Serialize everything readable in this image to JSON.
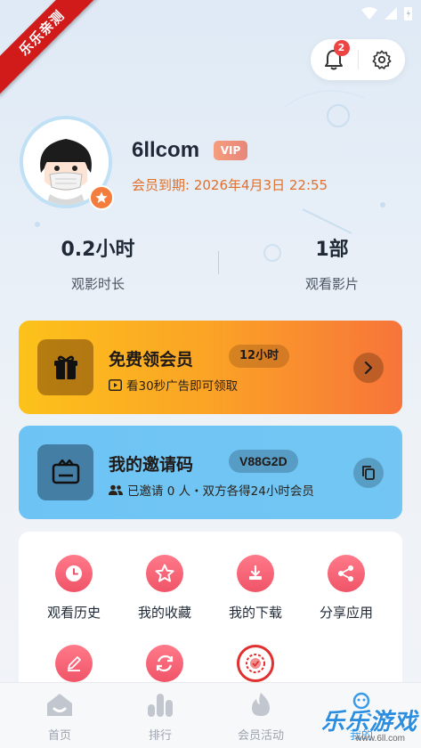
{
  "watermark": {
    "ribbon_text": "乐乐亲测",
    "logo_text": "乐乐游戏",
    "url_text": "www.6ll.com"
  },
  "header": {
    "notification_count": "2"
  },
  "profile": {
    "username": "6llcom",
    "vip_label": "VIP",
    "expire_text": "会员到期: 2026年4月3日 22:55"
  },
  "stats": [
    {
      "value": "0.2小时",
      "label": "观影时长"
    },
    {
      "value": "1部",
      "label": "观看影片"
    }
  ],
  "free_card": {
    "title": "免费领会员",
    "pill": "12小时",
    "subtitle": "看30秒广告即可领取"
  },
  "invite_card": {
    "title": "我的邀请码",
    "code": "V88G2D",
    "subtitle": "已邀请 0 人・双方各得24小时会员"
  },
  "menu": [
    {
      "label": "观看历史",
      "icon": "clock-icon"
    },
    {
      "label": "我的收藏",
      "icon": "star-icon"
    },
    {
      "label": "我的下载",
      "icon": "download-icon"
    },
    {
      "label": "分享应用",
      "icon": "share-icon"
    },
    {
      "label": "",
      "icon": "edit-icon"
    },
    {
      "label": "",
      "icon": "refresh-icon"
    },
    {
      "label": "",
      "icon": "badge-icon"
    }
  ],
  "bottom_nav": [
    {
      "label": "首页",
      "icon": "home-icon"
    },
    {
      "label": "排行",
      "icon": "rank-icon"
    },
    {
      "label": "会员活动",
      "icon": "fire-icon"
    },
    {
      "label": "我的",
      "icon": "profile-icon"
    }
  ],
  "colors": {
    "accent": "#f47c3c",
    "vip": "#e8857a",
    "menu_icon": "#f05468",
    "active_nav": "#3b9be8"
  }
}
